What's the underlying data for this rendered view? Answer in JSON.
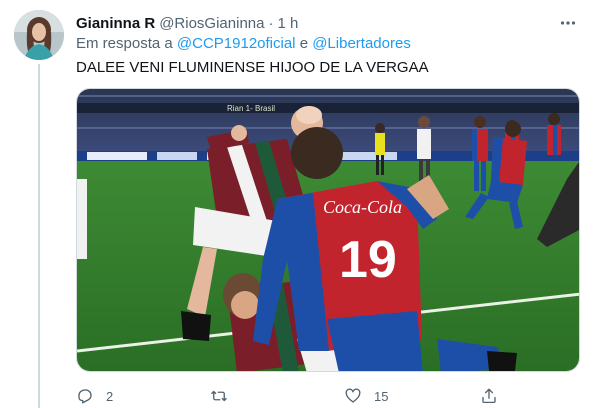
{
  "tweet": {
    "display_name": "Gianinna R",
    "handle": "@RiosGianinna",
    "separator": "·",
    "time": "1 h",
    "reply_prefix": "Em resposta a",
    "reply_user_1": "@CCP1912oficial",
    "reply_conjunction": "e",
    "reply_user_2": "@Libertadores",
    "text": "DALEE VENI FLUMINENSE HIJOO DE LA VERGAA",
    "photo_jersey_number": "19",
    "photo_jersey_brand": "Coca-Cola",
    "photo_scoreboard": "Rian 1- Brasil",
    "actions": {
      "reply_count": "2",
      "retweet_count": "",
      "like_count": "15"
    }
  },
  "colors": {
    "link": "#1d9bf0",
    "secondary_text": "#536471",
    "pitch": "#2f7a2a",
    "crowd": "#1c2c5c",
    "fluminense_grena": "#7a1e2a",
    "fluminense_green": "#1e5a3a",
    "tigre_blue": "#1e4fa8",
    "tigre_red": "#c2242e"
  },
  "icons": [
    "more-icon",
    "reply-icon",
    "retweet-icon",
    "like-icon",
    "share-icon"
  ]
}
